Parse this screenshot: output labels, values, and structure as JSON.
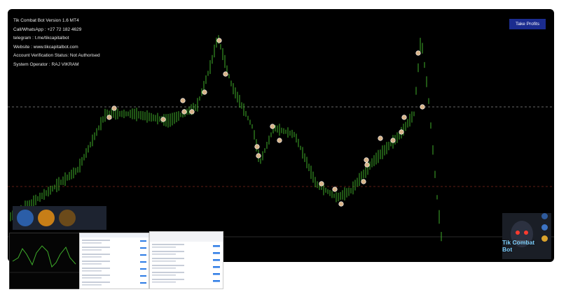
{
  "info": {
    "version": "Tik Combat Bot Version 1.6 MT4",
    "call": "Call/WhatsApp : +27 72 182 4629",
    "telegram": "telegram : t.me/tikcapitalbot",
    "website": "Website : www.tikcapitalbot.com",
    "account": "Account Verification Status: Not Authorised",
    "operator": "System Operator : RAJ VIKRAM"
  },
  "toolbar": {
    "take_profits": "Take Profits"
  },
  "brand": {
    "title": "Tik Combat Bot"
  },
  "colors": {
    "chart_bg": "#000000",
    "candle": "#3fae2a",
    "button": "#1b2c8f",
    "level_upper": "#cfcfcf",
    "level_lower": "#c0392b"
  },
  "icons": [
    "arrow-up-icon",
    "badge-icon",
    "gauge-icon",
    "robot-avatar-icon"
  ]
}
